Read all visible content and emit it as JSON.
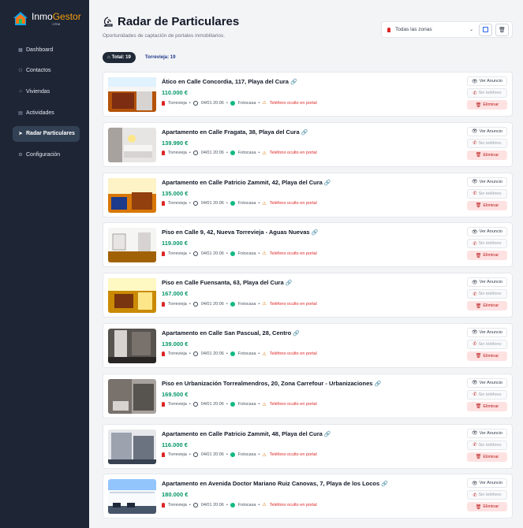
{
  "app": {
    "brand_a": "Inmo",
    "brand_b": "Gestor",
    "brand_sub": "CRM"
  },
  "nav": [
    {
      "label": "Dashboard",
      "icon": "grid-icon"
    },
    {
      "label": "Contactos",
      "icon": "users-icon"
    },
    {
      "label": "Viviendas",
      "icon": "home-icon"
    },
    {
      "label": "Actividades",
      "icon": "calendar-icon"
    },
    {
      "label": "Radar Particulares",
      "icon": "radar-icon",
      "active": true
    },
    {
      "label": "Configuración",
      "icon": "gear-icon"
    }
  ],
  "header": {
    "title": "Radar de Particulares",
    "subtitle": "Oportunidades de captación de portales inmobiliarios."
  },
  "filters": {
    "zone_value": "Todas las zonas"
  },
  "tabs": {
    "total": "Total: 19",
    "torrevieja": "Torrevieja: 19"
  },
  "card_labels": {
    "view": "Ver Anuncio",
    "phone": "Sin teléfono",
    "delete": "Eliminar",
    "hidden_phone": "Teléfono oculto en portal",
    "source": "Fotocasa",
    "sep": "•"
  },
  "listings": [
    {
      "title": "Ático en Calle Concordia, 117, Playa del Cura",
      "price": "110.000 €",
      "city": "Torrevieja",
      "date": "04/01 20:06",
      "img": "a"
    },
    {
      "title": "Apartamento en Calle Fragata, 38, Playa del Cura",
      "price": "139.990 €",
      "city": "Torrevieja",
      "date": "04/01 20:06",
      "img": "b"
    },
    {
      "title": "Apartamento en Calle Patricio Zammit, 42, Playa del Cura",
      "price": "135.000 €",
      "city": "Torrevieja",
      "date": "04/01 20:06",
      "img": "c"
    },
    {
      "title": "Piso en Calle 9, 42, Nueva Torrevieja - Aguas Nuevas",
      "price": "119.000 €",
      "city": "Torrevieja",
      "date": "04/01 20:06",
      "img": "d"
    },
    {
      "title": "Piso en Calle Fuensanta, 63, Playa del Cura",
      "price": "167.000 €",
      "city": "Torrevieja",
      "date": "04/01 20:06",
      "img": "e"
    },
    {
      "title": "Apartamento en Calle San Pascual, 28, Centro",
      "price": "139.000 €",
      "city": "Torrevieja",
      "date": "04/01 20:06",
      "img": "f"
    },
    {
      "title": "Piso en Urbanización Torrealmendros, 20, Zona Carrefour - Urbanizaciones",
      "price": "169.500 €",
      "city": "Torrevieja",
      "date": "04/01 20:06",
      "img": "g"
    },
    {
      "title": "Apartamento en Calle Patricio Zammit, 48, Playa del Cura",
      "price": "116.000 €",
      "city": "Torrevieja",
      "date": "04/01 20:06",
      "img": "h"
    },
    {
      "title": "Apartamento en Avenida Doctor Mariano Ruiz Canovas, 7, Playa de los Locos",
      "price": "180.000 €",
      "city": "Torrevieja",
      "date": "04/01 20:06",
      "img": "i"
    }
  ],
  "colors": {
    "sidebar": "#1e2535",
    "price": "#059669",
    "delete_bg": "#fee2e2",
    "warn": "#dc2626"
  }
}
